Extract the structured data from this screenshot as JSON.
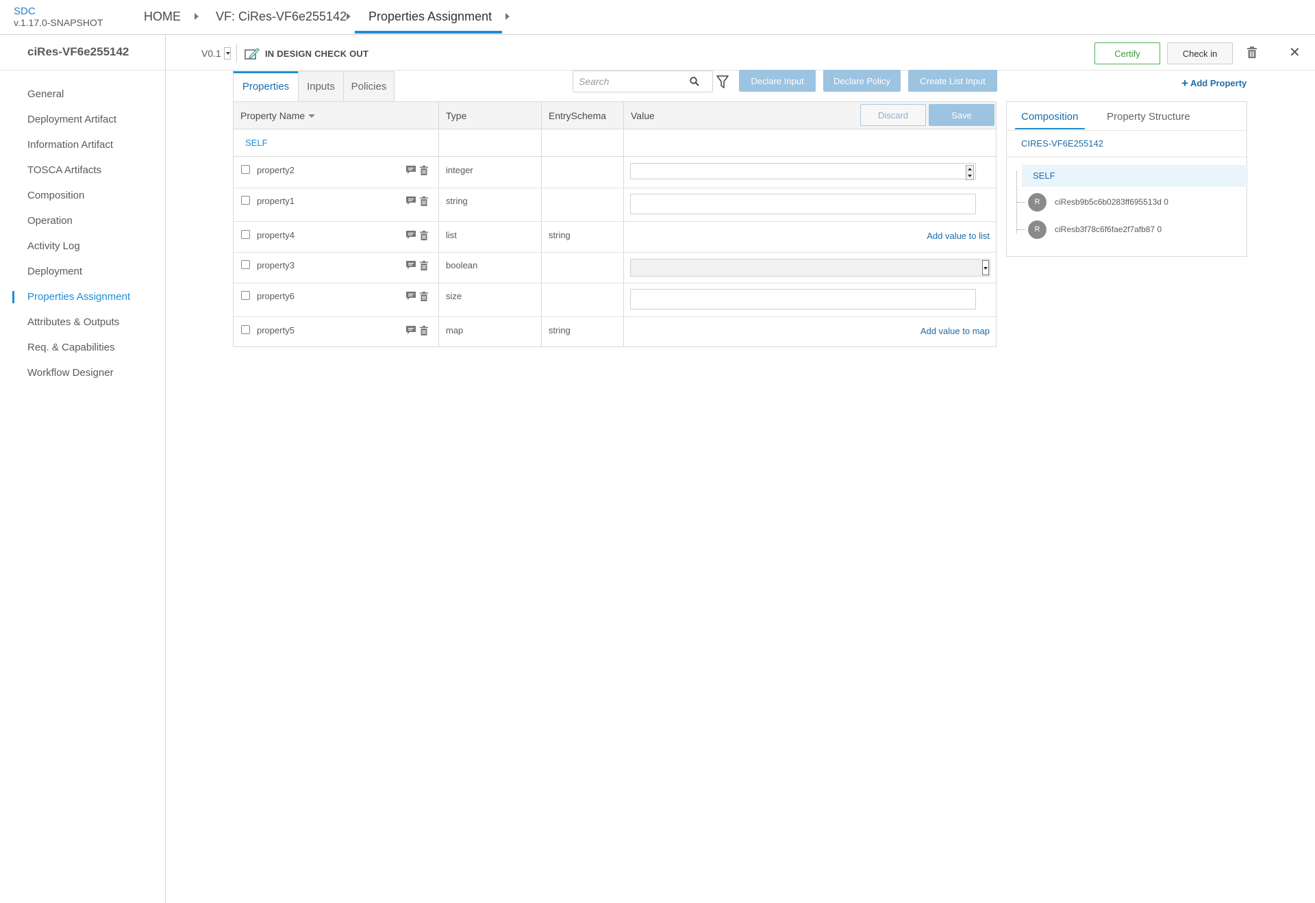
{
  "app": {
    "name": "SDC",
    "version": "v.1.17.0-SNAPSHOT"
  },
  "breadcrumbs": [
    {
      "label": "HOME"
    },
    {
      "label": "VF: CiRes-VF6e255142"
    },
    {
      "label": "Properties Assignment"
    }
  ],
  "sidebar": {
    "title": "ciRes-VF6e255142",
    "items": [
      {
        "label": "General"
      },
      {
        "label": "Deployment Artifact"
      },
      {
        "label": "Information Artifact"
      },
      {
        "label": "TOSCA Artifacts"
      },
      {
        "label": "Composition"
      },
      {
        "label": "Operation"
      },
      {
        "label": "Activity Log"
      },
      {
        "label": "Deployment"
      },
      {
        "label": "Properties Assignment"
      },
      {
        "label": "Attributes & Outputs"
      },
      {
        "label": "Req. & Capabilities"
      },
      {
        "label": "Workflow Designer"
      }
    ],
    "active_index": 8
  },
  "header": {
    "version": "V0.1",
    "status": "IN DESIGN CHECK OUT",
    "certify_label": "Certify",
    "checkin_label": "Check in"
  },
  "tabs": [
    {
      "label": "Properties"
    },
    {
      "label": "Inputs"
    },
    {
      "label": "Policies"
    }
  ],
  "toolbar": {
    "search_placeholder": "Search",
    "declare_input": "Declare Input",
    "declare_policy": "Declare Policy",
    "create_list_input": "Create List Input",
    "add_property": "Add Property"
  },
  "table": {
    "columns": {
      "name": "Property Name",
      "type": "Type",
      "schema": "EntrySchema",
      "value": "Value"
    },
    "discard_label": "Discard",
    "save_label": "Save",
    "group_label": "SELF",
    "rows": [
      {
        "name": "property2",
        "type": "integer",
        "schema": "",
        "value_kind": "number"
      },
      {
        "name": "property1",
        "type": "string",
        "schema": "",
        "value_kind": "text"
      },
      {
        "name": "property4",
        "type": "list",
        "schema": "string",
        "value_kind": "add",
        "add_label": "Add value to list"
      },
      {
        "name": "property3",
        "type": "boolean",
        "schema": "",
        "value_kind": "select"
      },
      {
        "name": "property6",
        "type": "size",
        "schema": "",
        "value_kind": "text"
      },
      {
        "name": "property5",
        "type": "map",
        "schema": "string",
        "value_kind": "add",
        "add_label": "Add value to map"
      }
    ]
  },
  "right_panel": {
    "tabs": [
      {
        "label": "Composition"
      },
      {
        "label": "Property Structure"
      }
    ],
    "component_name": "CIRES-VF6E255142",
    "self_label": "SELF",
    "nodes": [
      {
        "avatar": "R",
        "label": "ciResb9b5c6b0283ff695513d 0"
      },
      {
        "avatar": "R",
        "label": "ciResb3f78c6f6fae2f7afb87 0"
      }
    ]
  },
  "colors": {
    "accent": "#1d8dd6",
    "link": "#1d6ca8",
    "certify": "#4caf50",
    "disabled_button": "#9cc3e0"
  }
}
